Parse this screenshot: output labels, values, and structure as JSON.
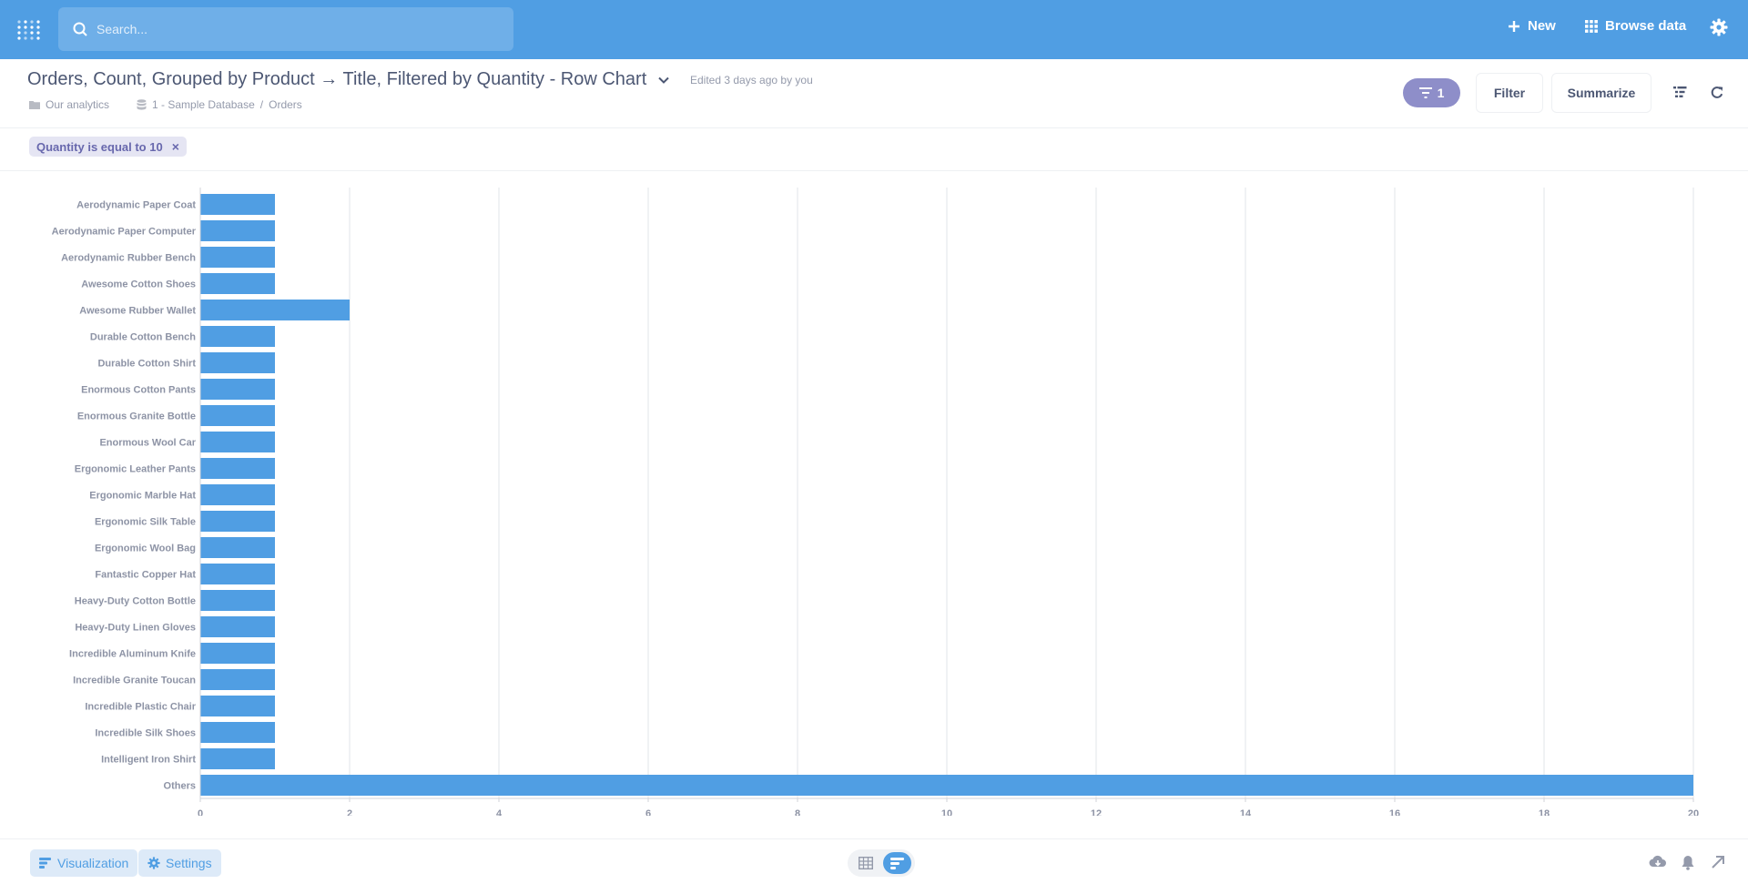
{
  "topbar": {
    "search_placeholder": "Search...",
    "new_label": "New",
    "browse_label": "Browse data"
  },
  "header": {
    "title": "Orders, Count, Grouped by Product → Title, Filtered by Quantity - Row Chart",
    "edited": "Edited 3 days ago by you",
    "breadcrumbs": {
      "collection": "Our analytics",
      "database": "1 - Sample Database",
      "separator": "/",
      "table": "Orders"
    },
    "filter_count": "1",
    "filter_label": "Filter",
    "summarize_label": "Summarize"
  },
  "filters": {
    "chip_label": "Quantity is equal to 10",
    "chip_close": "×"
  },
  "chart_data": {
    "type": "bar",
    "orientation": "horizontal",
    "categories": [
      "Aerodynamic Paper Coat",
      "Aerodynamic Paper Computer",
      "Aerodynamic Rubber Bench",
      "Awesome Cotton Shoes",
      "Awesome Rubber Wallet",
      "Durable Cotton Bench",
      "Durable Cotton Shirt",
      "Enormous Cotton Pants",
      "Enormous Granite Bottle",
      "Enormous Wool Car",
      "Ergonomic Leather Pants",
      "Ergonomic Marble Hat",
      "Ergonomic Silk Table",
      "Ergonomic Wool Bag",
      "Fantastic Copper Hat",
      "Heavy-Duty Cotton Bottle",
      "Heavy-Duty Linen Gloves",
      "Incredible Aluminum Knife",
      "Incredible Granite Toucan",
      "Incredible Plastic Chair",
      "Incredible Silk Shoes",
      "Intelligent Iron Shirt",
      "Others"
    ],
    "values": [
      1,
      1,
      1,
      1,
      2,
      1,
      1,
      1,
      1,
      1,
      1,
      1,
      1,
      1,
      1,
      1,
      1,
      1,
      1,
      1,
      1,
      1,
      20
    ],
    "xlim": [
      0,
      20
    ],
    "xticks": [
      "0",
      "2",
      "4",
      "6",
      "8",
      "10",
      "12",
      "14",
      "16",
      "18",
      "20"
    ],
    "grid": true,
    "color": "#509ee3"
  },
  "footer": {
    "visualization_label": "Visualization",
    "settings_label": "Settings"
  },
  "colors": {
    "brand": "#509ee3",
    "filter_accent": "#8e8ec9"
  }
}
